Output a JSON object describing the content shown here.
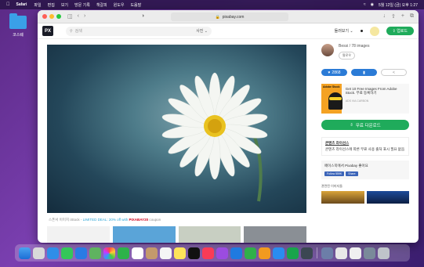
{
  "menubar": {
    "app": "Safari",
    "items": [
      "파일",
      "편집",
      "보기",
      "방문 기록",
      "책갈피",
      "윈도우",
      "도움말"
    ],
    "clock": "5월 12일 (금) 오후 1:27"
  },
  "desktop": {
    "folder_label": "코스웨"
  },
  "browser": {
    "url": "pixabay.com"
  },
  "site": {
    "logo": "PX",
    "search_placeholder": "검색",
    "search_type": "사진",
    "explore": "둘러보기",
    "upload": "업로드"
  },
  "photo": {
    "caption_prefix": "스폰서 이미지 iStock - ",
    "caption_deal": "LIMITED DEAL: 20% off with ",
    "caption_code": "PIXABAY20",
    "caption_suffix": " coupon"
  },
  "sidebar": {
    "author_line": "Bessi / 78 images",
    "follow": "팔로우",
    "likes": "2868",
    "ad_tag": "Adobe Stock",
    "ad_text": "Get 10 Free Images From Adobe Stock. 무료 등록하기",
    "ad_via": "ADS VIA CARBON",
    "download": "무료 다운로드",
    "license_title": "콘텐츠 라이선스",
    "license_text": "콘텐츠 라이선스에 따른 무료 사용 출처 표시 필요 없음",
    "fb_text": "페이스북에서 Pixabay 좋아요",
    "fb_follow": "Follow 559K",
    "fb_share": "Share",
    "related": "관련된 이미지들"
  },
  "colors": {
    "accent_green": "#1fab5b",
    "accent_blue": "#2b7bd6"
  }
}
